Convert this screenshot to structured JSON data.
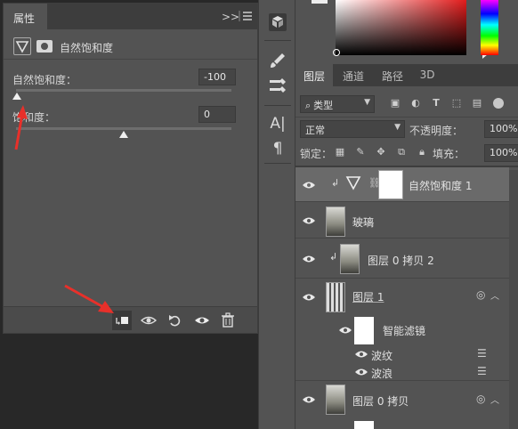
{
  "properties": {
    "tab_label": "属性",
    "expand_icon": ">>",
    "title": "自然饱和度",
    "vibrance_label": "自然饱和度：",
    "vibrance_value": "-100",
    "saturation_label": "饱和度：",
    "saturation_value": "0"
  },
  "layers_panel": {
    "tabs": [
      "图层",
      "通道",
      "路径",
      "3D"
    ],
    "filter_label": "类型",
    "blend_mode": "正常",
    "opacity_label": "不透明度：",
    "opacity_value": "100%",
    "lock_label": "锁定：",
    "fill_label": "填充：",
    "fill_value": "100%",
    "layers": [
      {
        "name": "自然饱和度 1"
      },
      {
        "name": "玻璃"
      },
      {
        "name": "图层 0 拷贝 2"
      },
      {
        "name": "图层 1"
      },
      {
        "name": "智能滤镜"
      },
      {
        "name": "波纹"
      },
      {
        "name": "波浪"
      },
      {
        "name": "图层 0 拷贝"
      }
    ]
  },
  "colors": {
    "accent_arrow": "#e8302a",
    "panel_bg": "#535353",
    "panel_dark": "#3d3d3d"
  }
}
